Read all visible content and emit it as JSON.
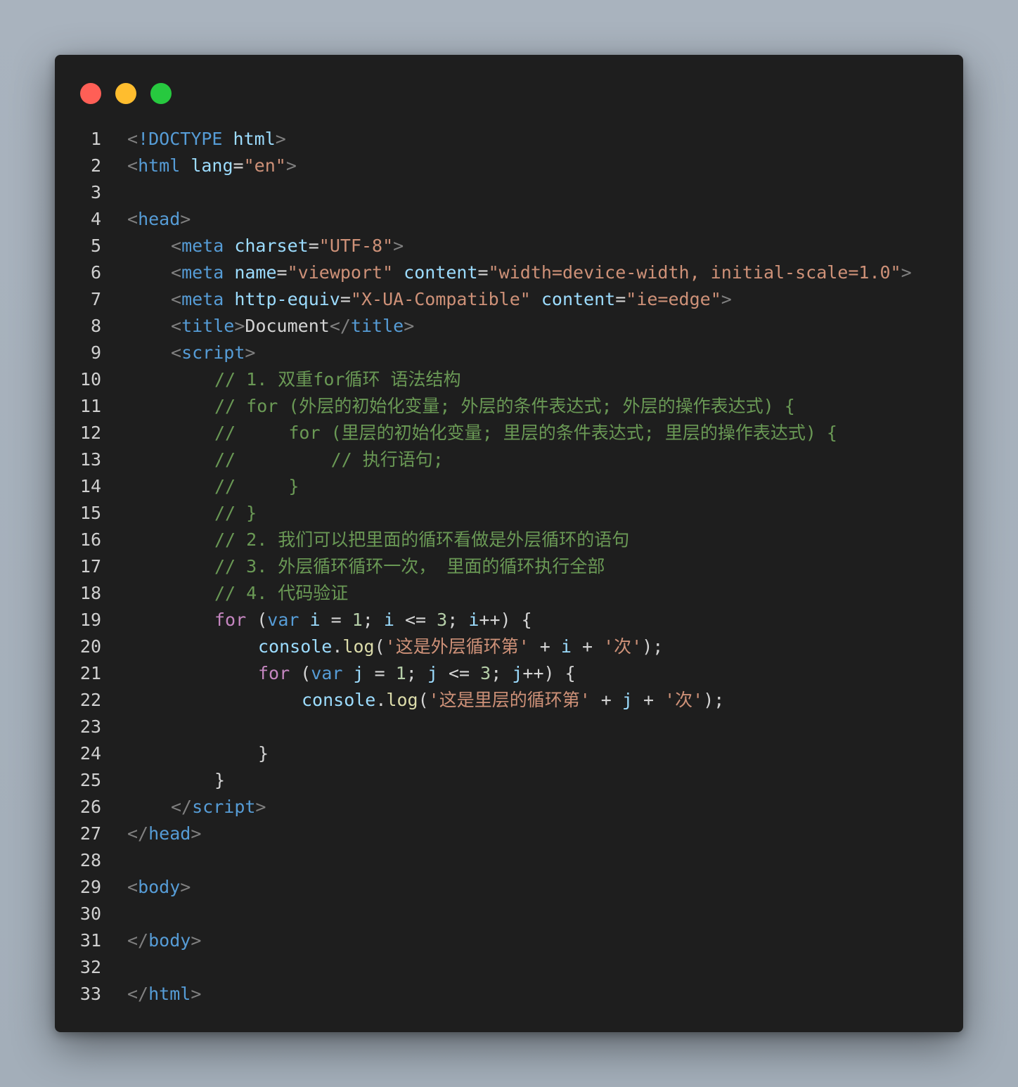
{
  "window": {
    "controls": [
      "close",
      "minimize",
      "maximize"
    ],
    "colors": {
      "close": "#ff5f56",
      "minimize": "#ffbd2e",
      "maximize": "#27c93f",
      "background": "#1e1e1e"
    }
  },
  "lines": {
    "1": {
      "num": "1",
      "a": "<",
      "b": "!DOCTYPE",
      "c": " html",
      "d": ">"
    },
    "2": {
      "num": "2",
      "a": "<",
      "b": "html",
      "c": " lang",
      "d": "=",
      "e": "\"en\"",
      "f": ">"
    },
    "3": {
      "num": "3"
    },
    "4": {
      "num": "4",
      "a": "<",
      "b": "head",
      "c": ">"
    },
    "5": {
      "num": "5",
      "a": "<",
      "b": "meta",
      "c": " charset",
      "d": "=",
      "e": "\"UTF-8\"",
      "f": ">"
    },
    "6": {
      "num": "6",
      "a": "<",
      "b": "meta",
      "c": " name",
      "d": "=",
      "e": "\"viewport\"",
      "f": " content",
      "g": "=",
      "h": "\"width=device-width, initial-scale=1.0\"",
      "i": ">"
    },
    "7": {
      "num": "7",
      "a": "<",
      "b": "meta",
      "c": " http-equiv",
      "d": "=",
      "e": "\"X-UA-Compatible\"",
      "f": " content",
      "g": "=",
      "h": "\"ie=edge\"",
      "i": ">"
    },
    "8": {
      "num": "8",
      "a": "<",
      "b": "title",
      "c": ">",
      "d": "Document",
      "e": "</",
      "f": "title",
      "g": ">"
    },
    "9": {
      "num": "9",
      "a": "<",
      "b": "script",
      "c": ">"
    },
    "10": {
      "num": "10",
      "cmt": "// 1. 双重for循环 语法结构"
    },
    "11": {
      "num": "11",
      "cmt": "// for (外层的初始化变量; 外层的条件表达式; 外层的操作表达式) {"
    },
    "12": {
      "num": "12",
      "cmt": "//     for (里层的初始化变量; 里层的条件表达式; 里层的操作表达式) {"
    },
    "13": {
      "num": "13",
      "cmt": "//         // 执行语句;"
    },
    "14": {
      "num": "14",
      "cmt": "//     }"
    },
    "15": {
      "num": "15",
      "cmt": "// }"
    },
    "16": {
      "num": "16",
      "cmt": "// 2. 我们可以把里面的循环看做是外层循环的语句"
    },
    "17": {
      "num": "17",
      "cmt": "// 3. 外层循环循环一次， 里面的循环执行全部"
    },
    "18": {
      "num": "18",
      "cmt": "// 4. 代码验证"
    },
    "19": {
      "num": "19",
      "a": "for",
      "b": " (",
      "c": "var",
      "d": " ",
      "e": "i",
      "f": " = ",
      "g": "1",
      "h": "; ",
      "i": "i",
      "j": " <= ",
      "k": "3",
      "l": "; ",
      "m": "i",
      "n": "++) {"
    },
    "20": {
      "num": "20",
      "a": "console",
      "b": ".",
      "c": "log",
      "d": "(",
      "e": "'这是外层循环第'",
      "f": " + ",
      "g": "i",
      "h": " + ",
      "i": "'次'",
      "j": ");"
    },
    "21": {
      "num": "21",
      "a": "for",
      "b": " (",
      "c": "var",
      "d": " ",
      "e": "j",
      "f": " = ",
      "g": "1",
      "h": "; ",
      "i": "j",
      "j": " <= ",
      "k": "3",
      "l": "; ",
      "m": "j",
      "n": "++) {"
    },
    "22": {
      "num": "22",
      "a": "console",
      "b": ".",
      "c": "log",
      "d": "(",
      "e": "'这是里层的循环第'",
      "f": " + ",
      "g": "j",
      "h": " + ",
      "i": "'次'",
      "j": ");"
    },
    "23": {
      "num": "23"
    },
    "24": {
      "num": "24",
      "a": "}"
    },
    "25": {
      "num": "25",
      "a": "}"
    },
    "26": {
      "num": "26",
      "a": "</",
      "b": "script",
      "c": ">"
    },
    "27": {
      "num": "27",
      "a": "</",
      "b": "head",
      "c": ">"
    },
    "28": {
      "num": "28"
    },
    "29": {
      "num": "29",
      "a": "<",
      "b": "body",
      "c": ">"
    },
    "30": {
      "num": "30"
    },
    "31": {
      "num": "31",
      "a": "</",
      "b": "body",
      "c": ">"
    },
    "32": {
      "num": "32"
    },
    "33": {
      "num": "33",
      "a": "</",
      "b": "html",
      "c": ">"
    }
  }
}
